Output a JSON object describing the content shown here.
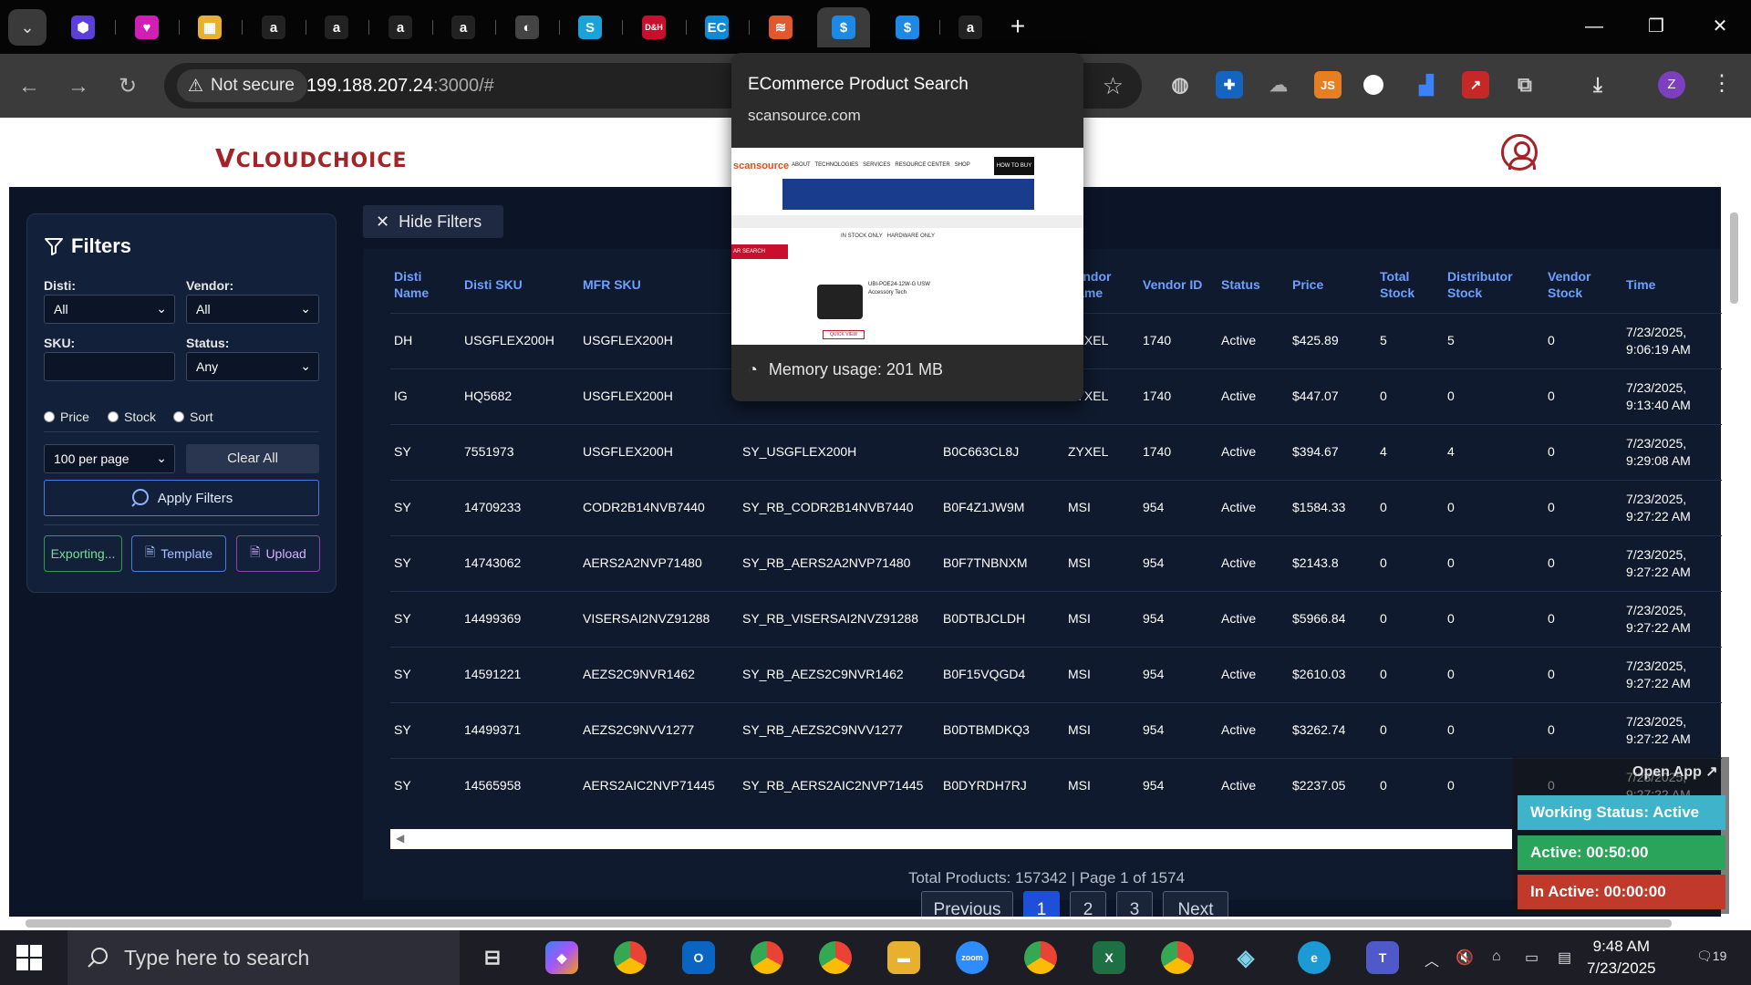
{
  "browser": {
    "tabs": [
      {
        "icon": "cube-icon",
        "color": "#5b3fd6",
        "glyph": "⬢"
      },
      {
        "icon": "heart-app-icon",
        "color": "#d11fb6",
        "glyph": "♥"
      },
      {
        "icon": "package-icon",
        "color": "#e8b02f",
        "glyph": "▦"
      },
      {
        "icon": "amazon-icon",
        "color": "#222222",
        "glyph": "a"
      },
      {
        "icon": "amazon-icon",
        "color": "#222222",
        "glyph": "a"
      },
      {
        "icon": "amazon-icon",
        "color": "#222222",
        "glyph": "a"
      },
      {
        "icon": "amazon-icon",
        "color": "#222222",
        "glyph": "a"
      },
      {
        "icon": "globe-icon",
        "color": "#444444",
        "glyph": "◐"
      },
      {
        "icon": "scansource-icon",
        "color": "#1aa3d9",
        "glyph": "S"
      },
      {
        "icon": "dh-icon",
        "color": "#c8102e",
        "glyph": "D&H"
      },
      {
        "icon": "ec-icon",
        "color": "#0f8ad6",
        "glyph": "EC"
      },
      {
        "icon": "stack-icon",
        "color": "#e4572e",
        "glyph": "≋"
      },
      {
        "icon": "dollar-icon",
        "color": "#1e88e5",
        "glyph": "$"
      },
      {
        "icon": "dollar-icon",
        "color": "#1e88e5",
        "glyph": "$"
      },
      {
        "icon": "amazon-icon",
        "color": "#222222",
        "glyph": "a"
      }
    ],
    "new_tab": "+",
    "minimize": "—",
    "restore": "❐",
    "close": "✕",
    "not_secure": "Not secure",
    "url_host": "199.188.207.24",
    "url_rest": ":3000/#",
    "profile_initial": "Z"
  },
  "preview": {
    "title": "ECommerce Product Search",
    "domain": "scansource.com",
    "memory": "Memory usage: 201 MB",
    "thumb": {
      "brand": "scansource",
      "nav": "ABOUT   TECHNOLOGIES   SERVICES   RESOURCE CENTER   SHOP",
      "cta": "HOW TO BUY",
      "search_label": "AR SEARCH",
      "filter": "IN STOCK ONLY   HARDWARE ONLY",
      "product": "UBI-POE24-12W-G USW Accessory Tech",
      "quick_view": "QUICK VIEW"
    }
  },
  "header": {
    "logo": "CLOUDCHOICE",
    "logo_v": "V"
  },
  "filters": {
    "title": "Filters",
    "disti_label": "Disti:",
    "disti_value": "All",
    "vendor_label": "Vendor:",
    "vendor_value": "All",
    "sku_label": "SKU:",
    "sku_value": "",
    "status_label": "Status:",
    "status_value": "Any",
    "radio_price": "Price",
    "radio_stock": "Stock",
    "radio_sort": "Sort",
    "per_page": "100 per page",
    "clear_all": "Clear All",
    "apply": "Apply Filters",
    "exporting": "Exporting...",
    "template": "Template",
    "upload": "Upload",
    "hide_filters": "Hide Filters"
  },
  "table": {
    "columns": [
      "Disti Name",
      "Disti SKU",
      "MFR SKU",
      "",
      "",
      "Vendor Name",
      "Vendor ID",
      "Status",
      "Price",
      "Total Stock",
      "Distributor Stock",
      "Vendor Stock",
      "Time"
    ],
    "rows": [
      [
        "DH",
        "USGFLEX200H",
        "USGFLEX200H",
        "",
        "",
        "ZYXEL",
        "1740",
        "Active",
        "$425.89",
        "5",
        "5",
        "0",
        "7/23/2025, 9:06:19 AM"
      ],
      [
        "IG",
        "HQ5682",
        "USGFLEX200H",
        "",
        "",
        "ZYXEL",
        "1740",
        "Active",
        "$447.07",
        "0",
        "0",
        "0",
        "7/23/2025, 9:13:40 AM"
      ],
      [
        "SY",
        "7551973",
        "USGFLEX200H",
        "SY_USGFLEX200H",
        "B0C663CL8J",
        "ZYXEL",
        "1740",
        "Active",
        "$394.67",
        "4",
        "4",
        "0",
        "7/23/2025, 9:29:08 AM"
      ],
      [
        "SY",
        "14709233",
        "CODR2B14NVB7440",
        "SY_RB_CODR2B14NVB7440",
        "B0F4Z1JW9M",
        "MSI",
        "954",
        "Active",
        "$1584.33",
        "0",
        "0",
        "0",
        "7/23/2025, 9:27:22 AM"
      ],
      [
        "SY",
        "14743062",
        "AERS2A2NVP71480",
        "SY_RB_AERS2A2NVP71480",
        "B0F7TNBNXM",
        "MSI",
        "954",
        "Active",
        "$2143.8",
        "0",
        "0",
        "0",
        "7/23/2025, 9:27:22 AM"
      ],
      [
        "SY",
        "14499369",
        "VISERSAI2NVZ91288",
        "SY_RB_VISERSAI2NVZ91288",
        "B0DTBJCLDH",
        "MSI",
        "954",
        "Active",
        "$5966.84",
        "0",
        "0",
        "0",
        "7/23/2025, 9:27:22 AM"
      ],
      [
        "SY",
        "14591221",
        "AEZS2C9NVR1462",
        "SY_RB_AEZS2C9NVR1462",
        "B0F15VQGD4",
        "MSI",
        "954",
        "Active",
        "$2610.03",
        "0",
        "0",
        "0",
        "7/23/2025, 9:27:22 AM"
      ],
      [
        "SY",
        "14499371",
        "AEZS2C9NVV1277",
        "SY_RB_AEZS2C9NVV1277",
        "B0DTBMDKQ3",
        "MSI",
        "954",
        "Active",
        "$3262.74",
        "0",
        "0",
        "0",
        "7/23/2025, 9:27:22 AM"
      ],
      [
        "SY",
        "14565958",
        "AERS2AIC2NVP71445",
        "SY_RB_AERS2AIC2NVP71445",
        "B0DYRDH7RJ",
        "MSI",
        "954",
        "Active",
        "$2237.05",
        "0",
        "0",
        "0",
        "7/23/2025, 9:27:22 AM"
      ]
    ],
    "totals": "Total Products: 157342 | Page 1 of 1574",
    "prev": "Previous",
    "pages": [
      "1",
      "2",
      "3"
    ],
    "next": "Next"
  },
  "work_status": {
    "open_app": "Open App ↗",
    "working": "Working Status: Active",
    "active": "Active: 00:50:00",
    "inactive": "In Active: 00:00:00"
  },
  "taskbar": {
    "search_placeholder": "Type here to search",
    "time": "9:48 AM",
    "date": "7/23/2025",
    "notifications": "19"
  }
}
